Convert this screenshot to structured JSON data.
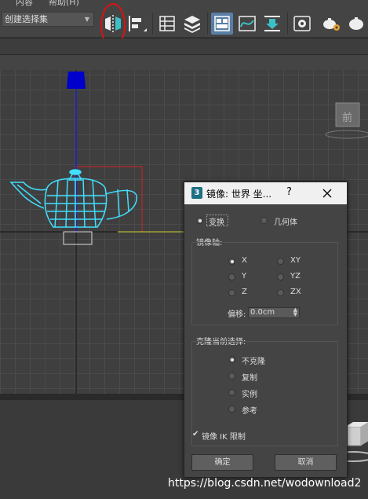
{
  "menubar": {
    "items": [
      "内容",
      "帮助(H)"
    ]
  },
  "toolbar": {
    "selection_set_value": "创建选择集",
    "icons": [
      "mirror-icon",
      "align-icon",
      "scene-explorer-icon",
      "layer-explorer-icon",
      "toggle-ribbon-icon",
      "curve-editor-icon",
      "schematic-view-icon",
      "material-editor-icon",
      "render-setup-icon",
      "rendered-frame-icon"
    ]
  },
  "viewport": {
    "cube_label": "前",
    "colors": {
      "grid": "#4b4b4b",
      "teapot": "#40e0ff",
      "axis_blue": "#2020e0",
      "axis_red": "#d02020",
      "axis_yellow": "#e0e040"
    }
  },
  "dialog": {
    "title": "镜像: 世界 坐...",
    "help": "?",
    "mode_options": [
      {
        "label": "变换",
        "selected": true
      },
      {
        "label": "几何体",
        "selected": false
      }
    ],
    "mirror_axis": {
      "title": "镜像轴:",
      "options": [
        {
          "label": "X",
          "selected": true
        },
        {
          "label": "Y",
          "selected": false
        },
        {
          "label": "Z",
          "selected": false
        },
        {
          "label": "XY",
          "selected": false
        },
        {
          "label": "YZ",
          "selected": false
        },
        {
          "label": "ZX",
          "selected": false
        }
      ],
      "offset_label": "偏移:",
      "offset_value": "0.0cm"
    },
    "clone": {
      "title": "克隆当前选择:",
      "options": [
        {
          "label": "不克隆",
          "selected": true
        },
        {
          "label": "复制",
          "selected": false
        },
        {
          "label": "实例",
          "selected": false
        },
        {
          "label": "参考",
          "selected": false
        }
      ]
    },
    "ik_limit": {
      "label": "镜像 IK 限制",
      "checked": true
    },
    "ok_label": "确定",
    "cancel_label": "取消"
  },
  "watermark": "https://blog.csdn.net/wodownload2"
}
